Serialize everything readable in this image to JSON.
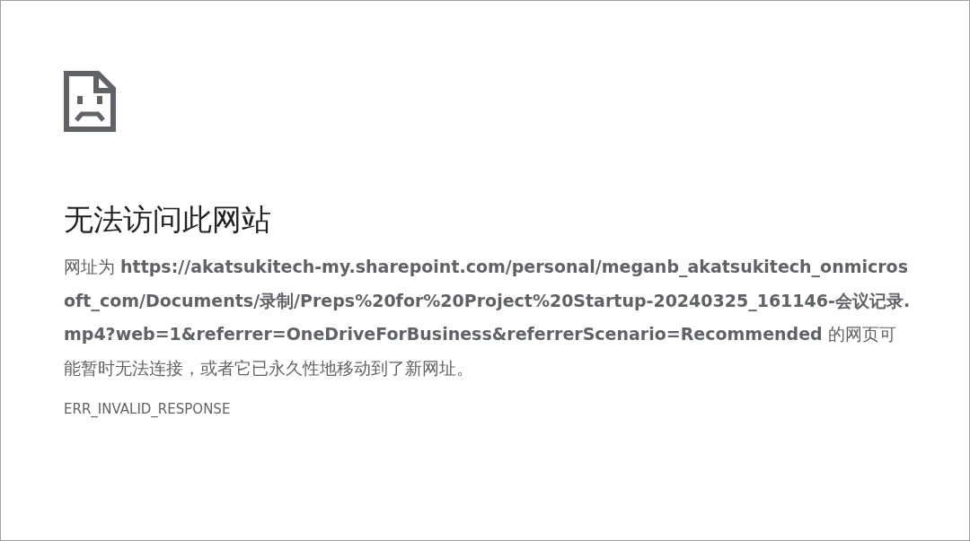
{
  "error_page": {
    "title": "无法访问此网站",
    "message": "网址为 **https://akatsukitech-my.sharepoint.com/personal/meganb_akatsukitech_onmicrosoft_com/Documents/录制/Preps%20for%20Project%20Startup-20240325_161146-会议记录.mp4?web=1&referrer=OneDriveForBusiness&referrerScenario=Recommended** 的网页可能暂时无法连接，或者它已永久性地移动到了新网址。",
    "error_code": "ERR_INVALID_RESPONSE"
  }
}
